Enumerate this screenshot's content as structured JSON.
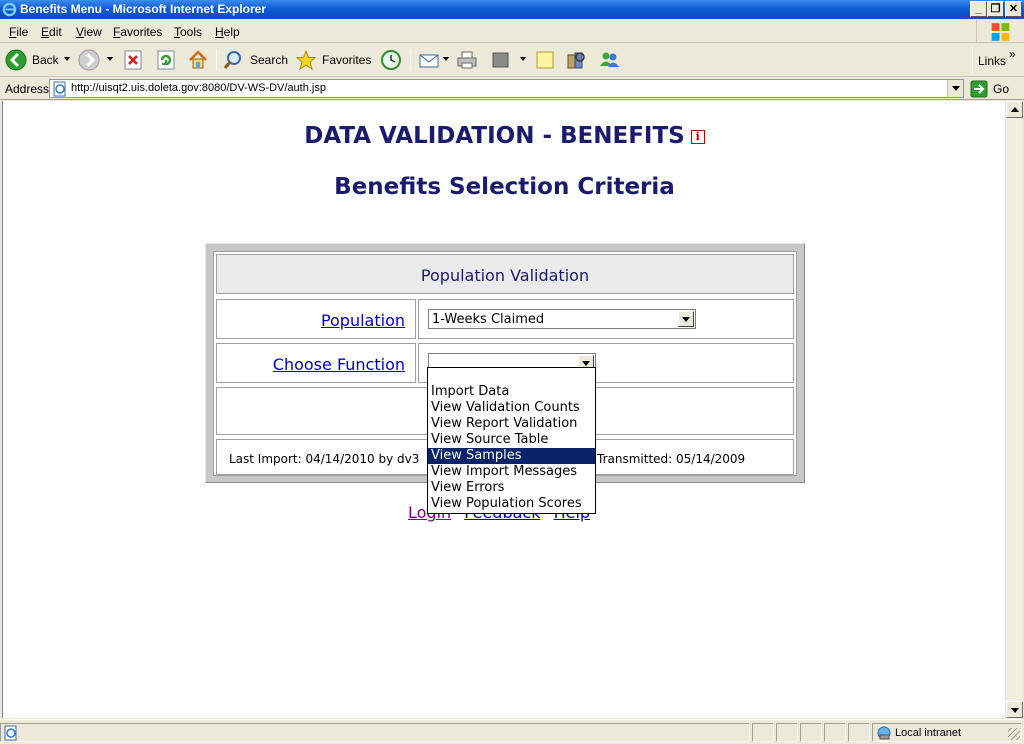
{
  "window": {
    "title": "Benefits Menu - Microsoft Internet Explorer",
    "controls": {
      "minimize": "_",
      "maximize": "❐",
      "close": "✕"
    }
  },
  "menubar": {
    "items": [
      {
        "label": "File",
        "accel": "F",
        "rest": "ile"
      },
      {
        "label": "Edit",
        "accel": "E",
        "rest": "dit"
      },
      {
        "label": "View",
        "accel": "V",
        "rest": "iew"
      },
      {
        "label": "Favorites",
        "accel": "F",
        "rest": "avorites"
      },
      {
        "label": "Tools",
        "accel": "T",
        "rest": "ools"
      },
      {
        "label": "Help",
        "accel": "H",
        "rest": "elp"
      }
    ]
  },
  "toolbar": {
    "back_label": "Back",
    "search_label": "Search",
    "favorites_label": "Favorites",
    "links_label": "Links",
    "links_chevron": "»"
  },
  "address": {
    "label": "Address",
    "url": "http://uisqt2.uis.doleta.gov:8080/DV-WS-DV/auth.jsp",
    "go_label": "Go"
  },
  "page": {
    "heading": "DATA VALIDATION - BENEFITS",
    "info_icon": "i",
    "subheading": "Benefits Selection Criteria",
    "panel_header": "Population Validation",
    "population_label": "Population",
    "population_value": "1-Weeks Claimed",
    "function_label": "Choose Function",
    "function_value": "",
    "last_import": "Last Import: 04/14/2010 by dv3",
    "transmitted": "Transmitted: 05/14/2009",
    "links": [
      "Login",
      "Feedback",
      "Help"
    ]
  },
  "function_options": [
    "",
    "Import Data",
    "View Validation Counts",
    "View Report Validation",
    "View Source Table",
    "View Samples",
    "View Import Messages",
    "View Errors",
    "View Population Scores"
  ],
  "function_selected_index": 5,
  "statusbar": {
    "zone": "Local intranet"
  },
  "colors": {
    "heading": "#1a1a6e",
    "link": "#0000cc",
    "visited_link": "#800080",
    "selection": "#0a246a"
  }
}
